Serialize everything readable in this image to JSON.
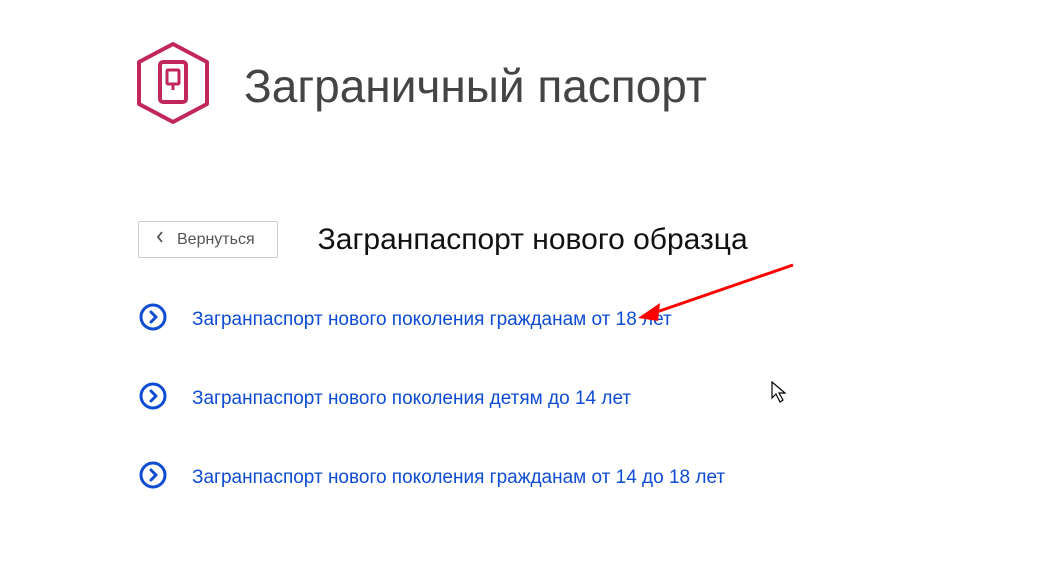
{
  "header": {
    "title": "Заграничный паспорт"
  },
  "back": {
    "label": "Вернуться"
  },
  "subtitle": "Загранпаспорт нового образца",
  "options": [
    {
      "label": "Загранпаспорт нового поколения гражданам от 18 лет"
    },
    {
      "label": "Загранпаспорт нового поколения детям до 14 лет"
    },
    {
      "label": "Загранпаспорт нового поколения гражданам от 14 до 18 лет"
    }
  ]
}
